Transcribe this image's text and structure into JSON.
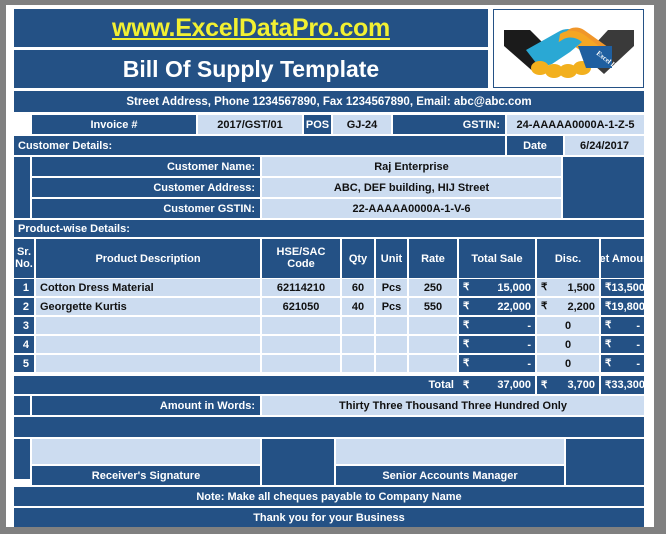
{
  "colors": {
    "dark_blue": "#245185",
    "light_blue": "#ccdcf0",
    "yellow": "#f2f032",
    "white": "#ffffff",
    "page_background": "#808080"
  },
  "header": {
    "website": "www.ExcelDataPro.com",
    "title": "Bill Of Supply Template",
    "address_line": "Street Address, Phone 1234567890, Fax 1234567890, Email: abc@abc.com",
    "logo_name": "handshake-logo",
    "logo_caption": "Excel Data Pro"
  },
  "invoice_meta": {
    "invoice_label": "Invoice #",
    "invoice_value": "2017/GST/01",
    "pos_label": "POS",
    "pos_value": "GJ-24",
    "gstin_label": "GSTIN:",
    "gstin_value": "24-AAAAA0000A-1-Z-5",
    "date_label": "Date",
    "date_value": "6/24/2017"
  },
  "customer": {
    "section_label": "Customer Details:",
    "name_label": "Customer Name:",
    "name_value": "Raj Enterprise",
    "address_label": "Customer Address:",
    "address_value": "ABC, DEF building, HIJ Street",
    "gstin_label": "Customer GSTIN:",
    "gstin_value": "22-AAAAA0000A-1-V-6"
  },
  "products": {
    "section_label": "Product-wise Details:",
    "columns": {
      "sr": "Sr. No.",
      "sr_line1": "Sr.",
      "sr_line2": "No.",
      "description": "Product Description",
      "hsn_line1": "HSE/SAC",
      "hsn_line2": "Code",
      "qty": "Qty",
      "unit": "Unit",
      "rate": "Rate",
      "total_sale": "Total Sale",
      "disc": "Disc.",
      "net_amount": "Net Amount"
    },
    "currency_symbol": "₹",
    "rows": [
      {
        "sr": "1",
        "description": "Cotton Dress Material",
        "hsn": "62114210",
        "qty": "60",
        "unit": "Pcs",
        "rate": "250",
        "total_sale": "15,000",
        "disc": "1,500",
        "net_amount": "13,500",
        "empty": false
      },
      {
        "sr": "2",
        "description": "Georgette Kurtis",
        "hsn": "621050",
        "qty": "40",
        "unit": "Pcs",
        "rate": "550",
        "total_sale": "22,000",
        "disc": "2,200",
        "net_amount": "19,800",
        "empty": false
      },
      {
        "sr": "3",
        "description": "",
        "hsn": "",
        "qty": "",
        "unit": "",
        "rate": "",
        "total_sale": "-",
        "disc": "0",
        "net_amount": "-",
        "empty": true
      },
      {
        "sr": "4",
        "description": "",
        "hsn": "",
        "qty": "",
        "unit": "",
        "rate": "",
        "total_sale": "-",
        "disc": "0",
        "net_amount": "-",
        "empty": true
      },
      {
        "sr": "5",
        "description": "",
        "hsn": "",
        "qty": "",
        "unit": "",
        "rate": "",
        "total_sale": "-",
        "disc": "0",
        "net_amount": "-",
        "empty": true
      }
    ]
  },
  "totals": {
    "label": "Total",
    "total_sale": "37,000",
    "disc": "3,700",
    "net_amount": "33,300"
  },
  "amount_in_words": {
    "label": "Amount in Words:",
    "value": "Thirty Three Thousand Three Hundred Only"
  },
  "signatures": {
    "receiver_label": "Receiver's Signature",
    "manager_label": "Senior Accounts Manager"
  },
  "footer": {
    "note": "Note: Make all cheques payable to Company Name",
    "thanks": "Thank you for your Business"
  }
}
